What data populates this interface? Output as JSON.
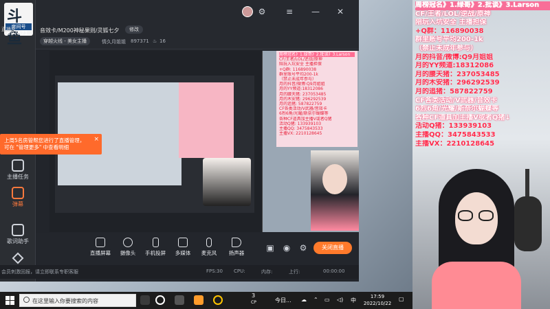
{
  "left_rail": {
    "logo_text": "斗鱼",
    "logo_tag": "房间号",
    "room_label": "直播名",
    "room_number": "897371",
    "items": [
      {
        "label": "主播任务",
        "icon": "calendar-icon",
        "active": false
      },
      {
        "label": "弹幕",
        "icon": "chat-icon",
        "active": true
      },
      {
        "label": "歌词助手",
        "icon": "music-icon",
        "active": false
      }
    ]
  },
  "stream": {
    "title": "音效卡/M200神秘果则/灵狐七夕",
    "edit_label": "修改",
    "category_tag": "穿越火线 - 美女主播",
    "meta": "情久月姐姐",
    "room_id": "897371",
    "heat": "16"
  },
  "tooltip": {
    "text": "上周5名房管帮您进行了直播管理，可在 \"管理更多\" 中查看明细",
    "close": "×"
  },
  "toolbar": {
    "items": [
      {
        "label": "直播屏幕",
        "icon": "screen-icon"
      },
      {
        "label": "摄像头",
        "icon": "camera-icon"
      },
      {
        "label": "手机投屏",
        "icon": "phone-icon"
      },
      {
        "label": "多媒体",
        "icon": "media-icon"
      },
      {
        "label": "麦克风",
        "icon": "mic-icon"
      },
      {
        "label": "扬声器",
        "icon": "speaker-icon"
      }
    ],
    "live_button": "关闭直播"
  },
  "statusbar": {
    "left_text": "会员刺激回报，请立即联系专职客服",
    "items": [
      "FPS:30",
      "CPU:",
      "内存:",
      "上行:",
      "00:00:00"
    ]
  },
  "preview_overlay_lines": [
    "周榜冠名》1.绿哥》2.批谈》3.Larson",
    "CF/王者/LOL/逆战/原神",
    "陪玩入坑安全  主播担保",
    "+Q群: 116890038",
    "群里账号平均200-1k",
    "（禁止未成年参与）",
    "月的抖音/微博:Q9月姐姐",
    "月的YY频道:18312086",
    "月的腰天猪: 237053485",
    "月的木安猪: 296292539",
    "月的追猪: 587822759",
    "CF各类活动/V武器/音效卡",
    "6烈6角/光耀/斯奈尔蝴蝶等",
    "各种CF道具加主播V或者Q猪",
    "活动Q猪: 133939103",
    "主播QQ: 3475843533",
    "主播VX: 2210128645"
  ],
  "taskbar": {
    "search_placeholder": "在这里输入你要搜索的内容",
    "weather": "今日...",
    "tray_number": "3",
    "tray_cp": "CP",
    "time": "17:59",
    "date": "2022/10/22",
    "ime": "中"
  },
  "right_panel": {
    "lines": [
      {
        "text": "周榜冠名》1.绿哥》2.批谈》3.Larson",
        "style": "hd"
      },
      {
        "text": "CF/王者/LOL/逆战/原神",
        "style": "white"
      },
      {
        "text": "陪玩入坑安全  主播担保",
        "style": "white"
      },
      {
        "text": "+Q群：116890038",
        "style": "red"
      },
      {
        "text": "群里账号平均200-1k",
        "style": "white"
      },
      {
        "text": "（禁止未成年参与）",
        "style": "white"
      },
      {
        "text": "月的抖音/微博:Q9月姐姐",
        "style": "red"
      },
      {
        "text": "月的YY频道:18312086",
        "style": "red"
      },
      {
        "text": "月的腰天猪：237053485",
        "style": "red"
      },
      {
        "text": "月的木安猪：296292539",
        "style": "red"
      },
      {
        "text": "月的追猪：587822759",
        "style": "red"
      },
      {
        "text": "CF各类活动/V武器/音效卡",
        "style": "white"
      },
      {
        "text": "6烈6角/光耀/斯奈尔蝴蝶等",
        "style": "white"
      },
      {
        "text": "各种CF道具加主播V或者Q猪↓",
        "style": "white"
      },
      {
        "text": "活动Q猪：133939103",
        "style": "red"
      },
      {
        "text": "主播QQ：3475843533",
        "style": "red"
      },
      {
        "text": "主播VX：2210128645",
        "style": "red"
      }
    ]
  },
  "colors": {
    "accent": "#ff7a2b",
    "overlay_red": "#ff2a4b",
    "overlay_pink": "#ff5c8c"
  }
}
